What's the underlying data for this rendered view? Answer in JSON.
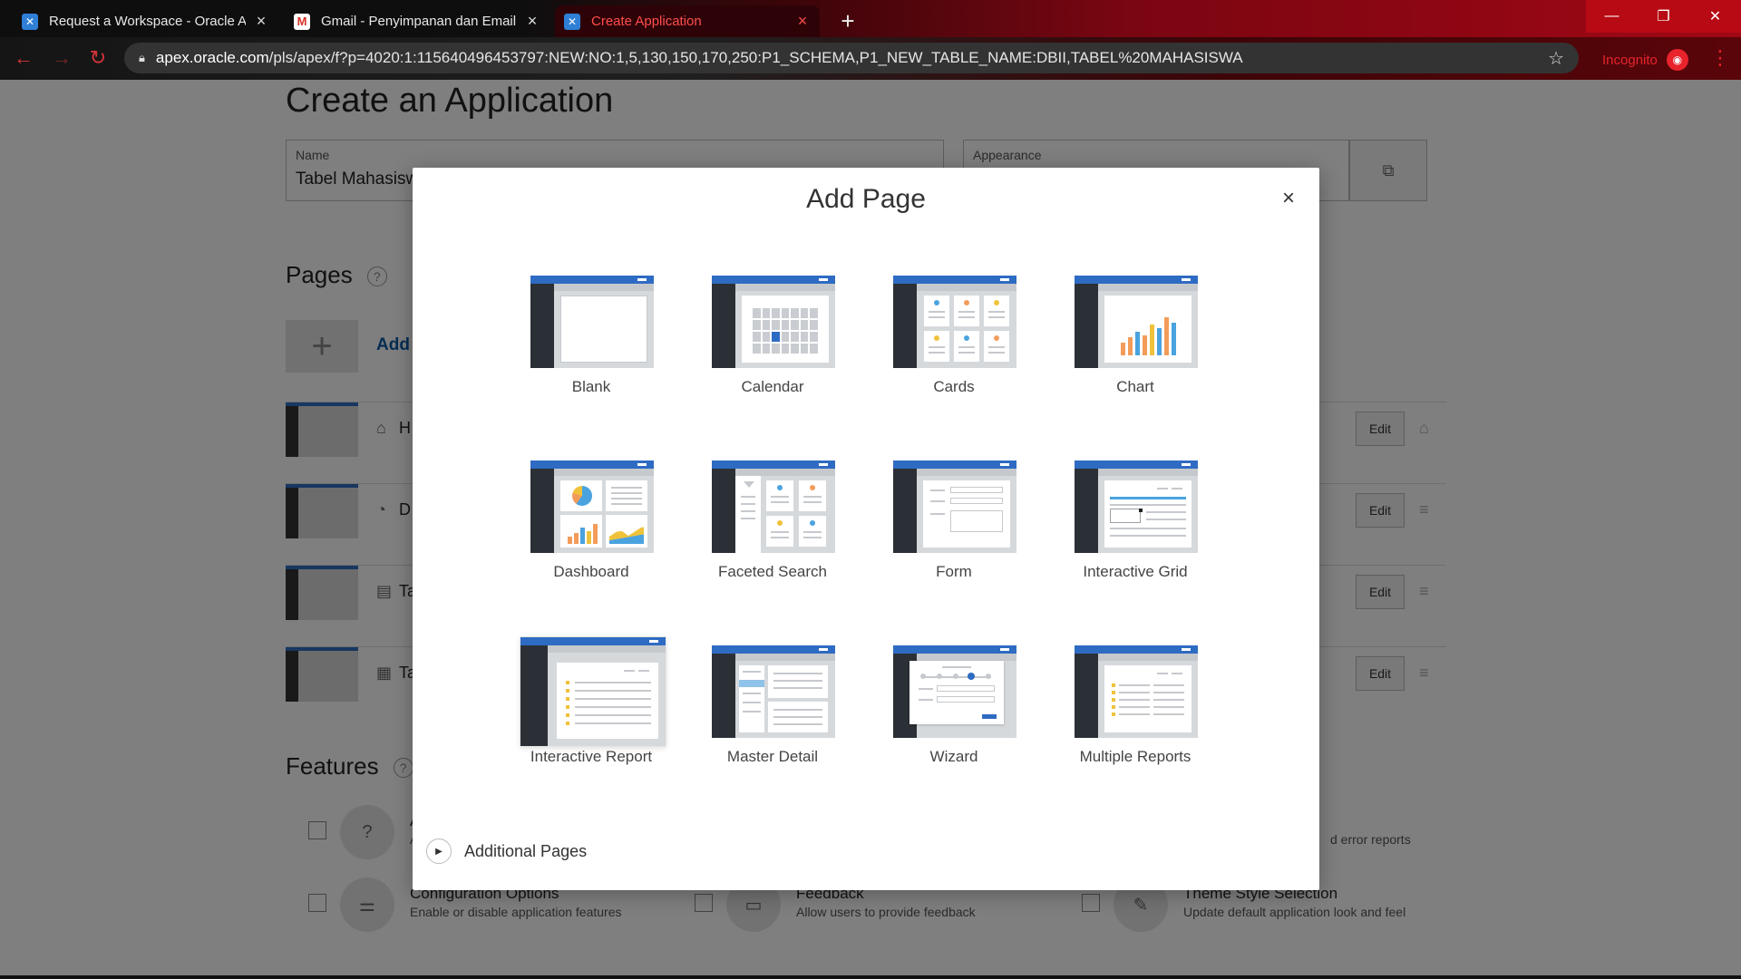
{
  "browser": {
    "tabs": [
      {
        "title": "Request a Workspace - Oracle Ap",
        "icon": "apex-icon"
      },
      {
        "title": "Gmail - Penyimpanan dan Email C",
        "icon": "gmail-icon"
      },
      {
        "title": "Create Application",
        "icon": "apex-icon"
      }
    ],
    "url_host": "apex.oracle.com",
    "url_path": "/pls/apex/f?p=4020:1:115640496453797:NEW:NO:1,5,130,150,170,250:P1_SCHEMA,P1_NEW_TABLE_NAME:DBII,TABEL%20MAHASISWA",
    "incognito_label": "Incognito"
  },
  "page": {
    "title": "Create an Application",
    "name_label": "Name",
    "name_value": "Tabel Mahasisw",
    "appearance_label": "Appearance",
    "pages_title": "Pages",
    "add_label": "Add",
    "rows": [
      {
        "name_prefix": "H",
        "icon": "home-icon",
        "edit": "Edit"
      },
      {
        "name_prefix": "D",
        "icon": "dashboard-icon",
        "edit": "Edit"
      },
      {
        "name_prefix": "Ta",
        "icon": "table-search-icon",
        "edit": "Edit"
      },
      {
        "name_prefix": "Ta",
        "icon": "table-icon",
        "edit": "Edit"
      }
    ],
    "features_title": "Features",
    "features": [
      {
        "title": "A",
        "desc": "A",
        "icon": "help-icon"
      },
      {
        "title": "Configuration Options",
        "desc": "Enable or disable application features",
        "icon": "sliders-icon"
      },
      {
        "title": "Feedback",
        "desc": "Allow users to provide feedback",
        "icon": "comment-icon"
      },
      {
        "title": "Theme Style Selection",
        "desc": "Update default application look and feel",
        "icon": "brush-icon"
      }
    ],
    "error_reports_tail": "d error reports"
  },
  "modal": {
    "title": "Add Page",
    "options": [
      {
        "label": "Blank"
      },
      {
        "label": "Calendar"
      },
      {
        "label": "Cards"
      },
      {
        "label": "Chart"
      },
      {
        "label": "Dashboard"
      },
      {
        "label": "Faceted Search"
      },
      {
        "label": "Form"
      },
      {
        "label": "Interactive Grid"
      },
      {
        "label": "Interactive Report"
      },
      {
        "label": "Master Detail"
      },
      {
        "label": "Wizard"
      },
      {
        "label": "Multiple Reports"
      }
    ],
    "additional_pages": "Additional Pages"
  },
  "colors": {
    "brand_blue": "#2e6bc3",
    "sidebar_dark": "#2b3036",
    "incognito_red": "#e8232c"
  }
}
